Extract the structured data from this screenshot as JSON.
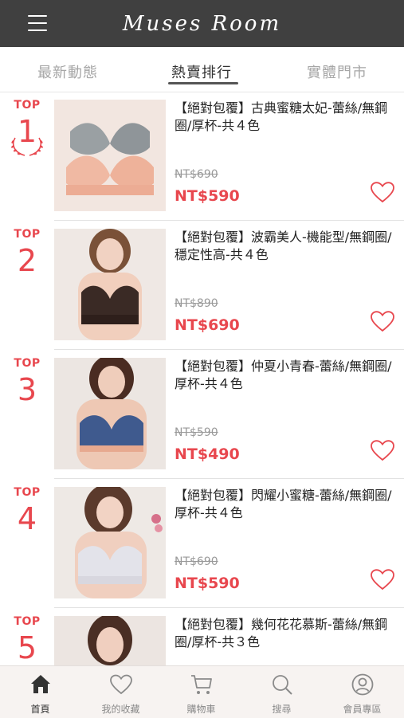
{
  "header": {
    "logo": "Muses Room"
  },
  "tabs": [
    {
      "label": "最新動態"
    },
    {
      "label": "熱賣排行"
    },
    {
      "label": "實體門市"
    }
  ],
  "products": [
    {
      "rank_top": "TOP",
      "rank": "1",
      "title": "【絕對包覆】古典蜜糖太妃-蕾絲/無鋼圈/厚杯-共４色",
      "old_price": "NT$690",
      "price": "NT$590"
    },
    {
      "rank_top": "TOP",
      "rank": "2",
      "title": "【絕對包覆】波霸美人-機能型/無鋼圈/穩定性高-共４色",
      "old_price": "NT$890",
      "price": "NT$690"
    },
    {
      "rank_top": "TOP",
      "rank": "3",
      "title": "【絕對包覆】仲夏小青春-蕾絲/無鋼圈/厚杯-共４色",
      "old_price": "NT$590",
      "price": "NT$490"
    },
    {
      "rank_top": "TOP",
      "rank": "4",
      "title": "【絕對包覆】閃耀小蜜糖-蕾絲/無鋼圈/厚杯-共４色",
      "old_price": "NT$690",
      "price": "NT$590"
    },
    {
      "rank_top": "TOP",
      "rank": "5",
      "title": "【絕對包覆】幾何花花慕斯-蕾絲/無鋼圈/厚杯-共３色",
      "old_price": "",
      "price": ""
    }
  ],
  "bottom_nav": [
    {
      "label": "首頁",
      "icon": "home-icon"
    },
    {
      "label": "我的收藏",
      "icon": "heart-icon"
    },
    {
      "label": "購物車",
      "icon": "cart-icon"
    },
    {
      "label": "搜尋",
      "icon": "search-icon"
    },
    {
      "label": "會員專區",
      "icon": "user-icon"
    }
  ],
  "colors": {
    "accent": "#e8474e",
    "header_bg": "#404040"
  }
}
